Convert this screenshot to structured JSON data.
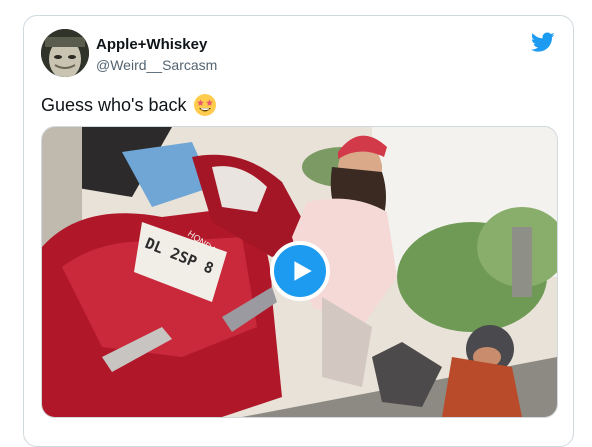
{
  "tweet": {
    "author_name": "Apple+Whiskey",
    "author_handle": "@Weird__Sarcasm",
    "text": "Guess who's back",
    "emoji": "star-struck-emoji"
  },
  "media": {
    "type": "video",
    "plate_text": "DL 2SP 8",
    "brand_text": "HONDA"
  },
  "colors": {
    "twitter_blue": "#1d9bf0",
    "scooter_red": "#b0182a",
    "text_primary": "#0f1419",
    "text_secondary": "#536471",
    "border": "#cfd9de"
  },
  "icons": [
    "twitter-bird-icon",
    "play-icon",
    "star-struck-emoji"
  ]
}
